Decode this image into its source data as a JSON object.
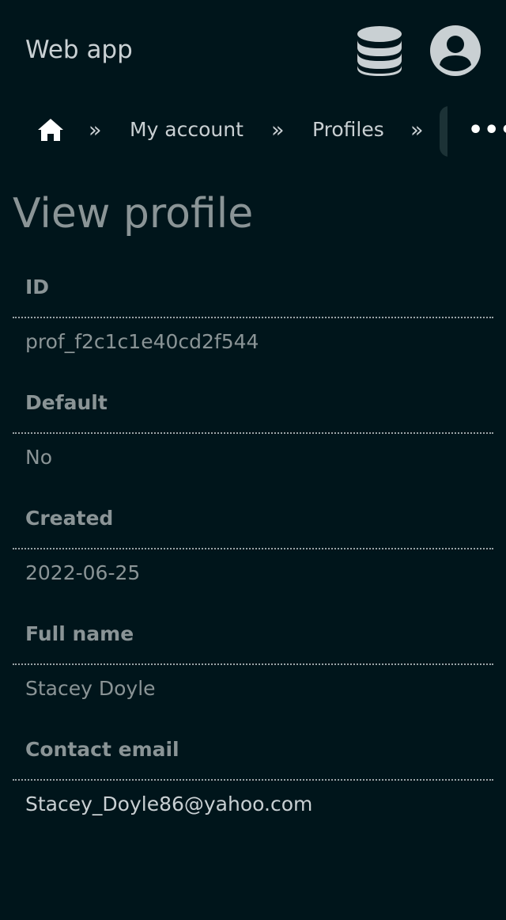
{
  "header": {
    "app_title": "Web app"
  },
  "breadcrumb": {
    "separator": "»",
    "items": [
      {
        "label": "My account"
      },
      {
        "label": "Profiles"
      }
    ],
    "more_label": "•••"
  },
  "page": {
    "title": "View profile"
  },
  "profile": {
    "fields": [
      {
        "label": "ID",
        "value": "prof_f2c1c1e40cd2f544"
      },
      {
        "label": "Default",
        "value": "No"
      },
      {
        "label": "Created",
        "value": "2022-06-25"
      },
      {
        "label": "Full name",
        "value": "Stacey Doyle"
      },
      {
        "label": "Contact email",
        "value": "Stacey_Doyle86@yahoo.com"
      }
    ]
  },
  "icons": {
    "database": "database-icon",
    "account": "account-circle-icon",
    "home": "home-icon",
    "more": "more-horizontal-icon"
  },
  "colors": {
    "background": "#00151b",
    "text_primary": "#c9d0d3",
    "text_muted": "#8a9496",
    "more_button_accent": "#1c3236"
  }
}
